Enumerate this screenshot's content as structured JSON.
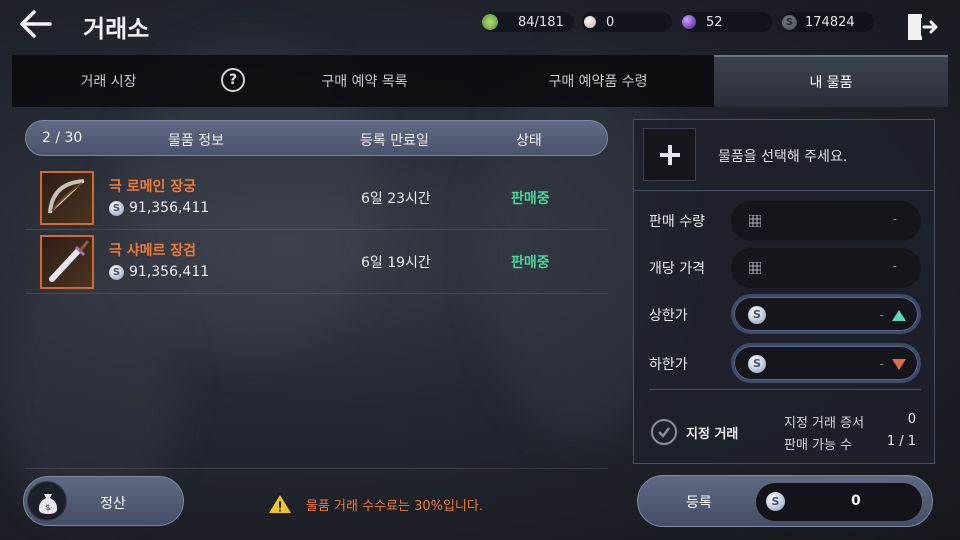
{
  "header": {
    "title": "거래소",
    "resources": [
      {
        "name": "energy",
        "icon": "green-gem-icon",
        "value": "84/181",
        "color": "#7fbf5a"
      },
      {
        "name": "pearl",
        "icon": "pearl-icon",
        "value": "0",
        "color": "#d9c6c6"
      },
      {
        "name": "purple-orb",
        "icon": "purple-orb-icon",
        "value": "52",
        "color": "#7b3fd1"
      },
      {
        "name": "silver",
        "icon": "silver-coin-icon",
        "value": "174824",
        "color": "#c2ccdd"
      }
    ]
  },
  "tabs": [
    {
      "label": "거래 시장",
      "active": false
    },
    {
      "label": "구매 예약 목록",
      "active": false
    },
    {
      "label": "구매 예약품 수령",
      "active": false
    },
    {
      "label": "내 물품",
      "active": true
    }
  ],
  "help_label": "?",
  "list": {
    "count": "2 / 30",
    "col_info": "물품 정보",
    "col_expiry": "등록 만료일",
    "col_status": "상태",
    "items": [
      {
        "name": "극 로메인 장궁",
        "price": "91,356,411",
        "expiry": "6일 23시간",
        "status": "판매중",
        "icon": "longbow-icon"
      },
      {
        "name": "극 샤메르 장검",
        "price": "91,356,411",
        "expiry": "6일 19시간",
        "status": "판매중",
        "icon": "longsword-icon"
      }
    ]
  },
  "footer": {
    "settle_label": "정산",
    "fee_notice": "물품 거래 수수료는 30%입니다."
  },
  "panel": {
    "select_hint": "물품을 선택해 주세요.",
    "sale_qty_label": "판매 수량",
    "sale_qty_value": "-",
    "unit_price_label": "개당 가격",
    "unit_price_value": "-",
    "upper_label": "상한가",
    "upper_value": "-",
    "lower_label": "하한가",
    "lower_value": "-",
    "designated_label": "지정 거래",
    "designated_cert_label": "지정 거래 증서",
    "designated_cert_value": "0",
    "sellable_label": "판매 가능 수",
    "sellable_value": "1 / 1"
  },
  "register": {
    "label": "등록",
    "price": "0"
  },
  "colors": {
    "accent_orange": "#ee7a38",
    "status_green": "#4ad39a",
    "up_arrow": "#5fd6c0",
    "down_arrow": "#e06a4a"
  }
}
